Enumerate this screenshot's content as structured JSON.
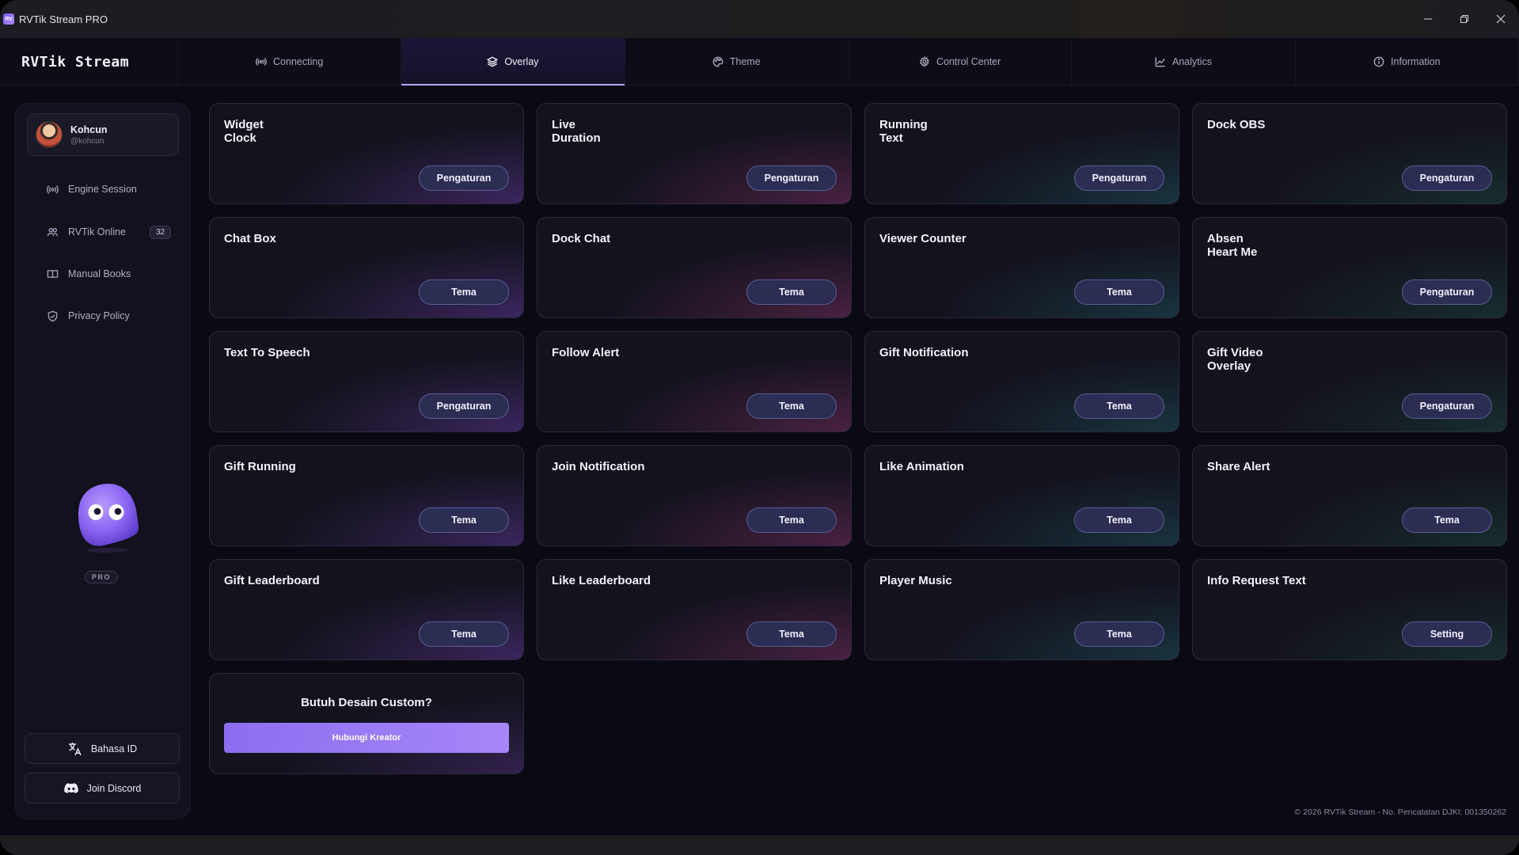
{
  "window": {
    "title": "RVTik Stream PRO",
    "icon_text": "RV",
    "controls": [
      "minimize-icon",
      "restore-icon",
      "close-icon"
    ]
  },
  "header": {
    "logo": "RVTik Stream",
    "tabs": [
      {
        "label": "Connecting",
        "icon": "broadcast-icon"
      },
      {
        "label": "Overlay",
        "icon": "layers-icon",
        "active": true
      },
      {
        "label": "Theme",
        "icon": "palette-icon"
      },
      {
        "label": "Control Center",
        "icon": "gear-icon"
      },
      {
        "label": "Analytics",
        "icon": "chart-icon"
      },
      {
        "label": "Information",
        "icon": "info-icon"
      }
    ]
  },
  "sidebar": {
    "profile": {
      "name": "Kohcun",
      "handle": "@kohcun"
    },
    "items": [
      {
        "label": "Engine Session",
        "icon": "broadcast-icon"
      },
      {
        "label": "RVTik Online",
        "icon": "users-icon",
        "badge": "32"
      },
      {
        "label": "Manual Books",
        "icon": "book-icon"
      },
      {
        "label": "Privacy Policy",
        "icon": "shield-icon"
      }
    ],
    "pro_label": "PRO",
    "language_button": "Bahasa ID",
    "discord_button": "Join Discord"
  },
  "cards": [
    {
      "title": "Widget\nClock",
      "button": "Pengaturan"
    },
    {
      "title": "Live\nDuration",
      "button": "Pengaturan"
    },
    {
      "title": "Running\nText",
      "button": "Pengaturan"
    },
    {
      "title": "Dock OBS",
      "button": "Pengaturan"
    },
    {
      "title": "Chat Box",
      "button": "Tema"
    },
    {
      "title": "Dock Chat",
      "button": "Tema"
    },
    {
      "title": "Viewer Counter",
      "button": "Tema"
    },
    {
      "title": "Absen\nHeart Me",
      "button": "Pengaturan"
    },
    {
      "title": "Text To Speech",
      "button": "Pengaturan"
    },
    {
      "title": "Follow Alert",
      "button": "Tema"
    },
    {
      "title": "Gift Notification",
      "button": "Tema"
    },
    {
      "title": "Gift Video\nOverlay",
      "button": "Pengaturan"
    },
    {
      "title": "Gift Running",
      "button": "Tema"
    },
    {
      "title": "Join Notification",
      "button": "Tema"
    },
    {
      "title": "Like Animation",
      "button": "Tema"
    },
    {
      "title": "Share Alert",
      "button": "Tema"
    },
    {
      "title": "Gift Leaderboard",
      "button": "Tema"
    },
    {
      "title": "Like Leaderboard",
      "button": "Tema"
    },
    {
      "title": "Player Music",
      "button": "Tema"
    },
    {
      "title": "Info Request Text",
      "button": "Setting"
    }
  ],
  "custom_design": {
    "title": "Butuh Desain Custom?",
    "button": "Hubungi Kreator"
  },
  "footer": "© 2026 RVTik Stream - No. Pencatatan DJKI: 001350262",
  "colors": {
    "accent": "#b7a6ff",
    "button_bg": "#2b2d52",
    "cta": "#9b7ef5",
    "background": "#0b0a14"
  }
}
